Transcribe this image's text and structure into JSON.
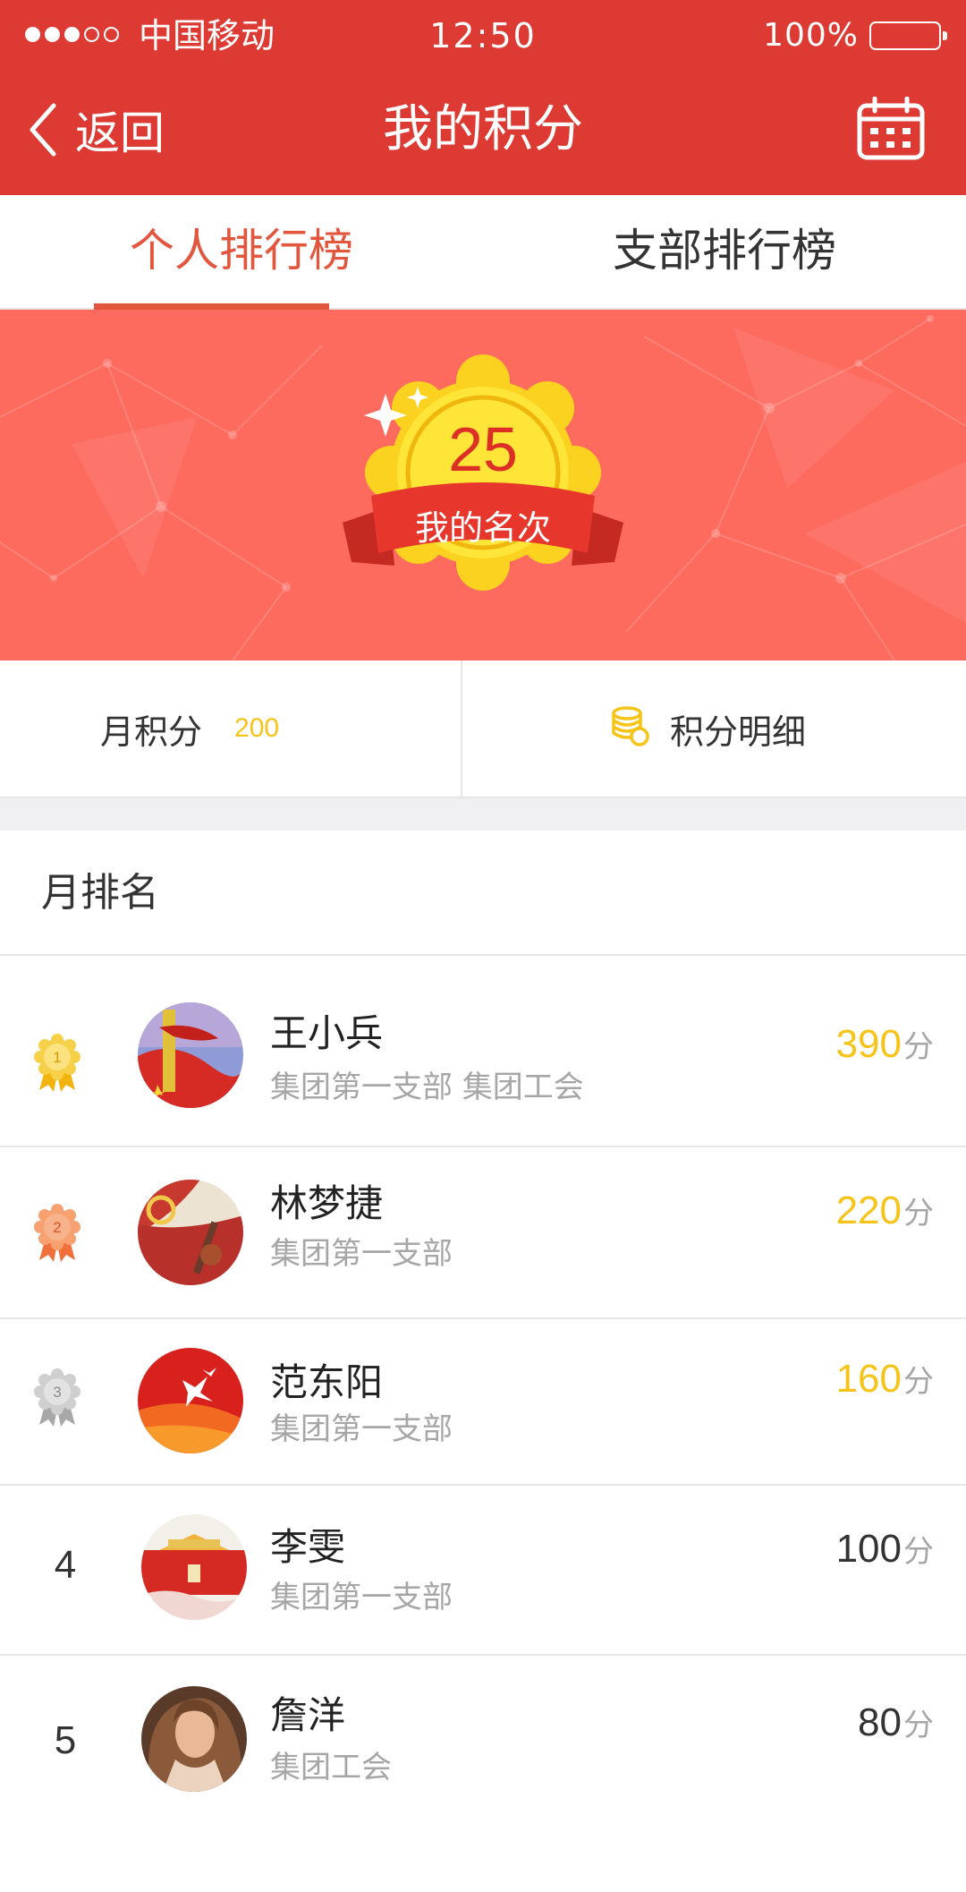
{
  "status_bar": {
    "carrier": "中国移动",
    "time": "12:50",
    "battery": "100%",
    "signal_bars_filled": 3,
    "signal_bars_total": 5
  },
  "nav": {
    "back_label": "返回",
    "title": "我的积分",
    "right_icon": "calendar-icon"
  },
  "tabs": [
    {
      "label": "个人排行榜",
      "active": true
    },
    {
      "label": "支部排行榜",
      "active": false
    }
  ],
  "my_rank": {
    "number": "25",
    "label": "我的名次"
  },
  "points": {
    "monthly_label": "月积分",
    "monthly_value": "200",
    "detail_label": "积分明细",
    "detail_icon": "coins-icon"
  },
  "ranking": {
    "title": "月排名",
    "items": [
      {
        "rank": "1",
        "name": "王小兵",
        "dept": "集团第一支部  集团工会",
        "score": "390",
        "unit": "分",
        "medal": "gold"
      },
      {
        "rank": "2",
        "name": "林梦捷",
        "dept": "集团第一支部",
        "score": "220",
        "unit": "分",
        "medal": "bronze"
      },
      {
        "rank": "3",
        "name": "范东阳",
        "dept": "集团第一支部",
        "score": "160",
        "unit": "分",
        "medal": "silver"
      },
      {
        "rank": "4",
        "name": "李雯",
        "dept": "集团第一支部",
        "score": "100",
        "unit": "分",
        "medal": ""
      },
      {
        "rank": "5",
        "name": "詹洋",
        "dept": "集团工会",
        "score": "80",
        "unit": "分",
        "medal": ""
      }
    ]
  },
  "colors": {
    "primary_red": "#dc3a33",
    "banner_red": "#fd6a5e",
    "tab_active": "#e2563e",
    "gold": "#f6c418",
    "gray_text": "#a6a6a6"
  }
}
